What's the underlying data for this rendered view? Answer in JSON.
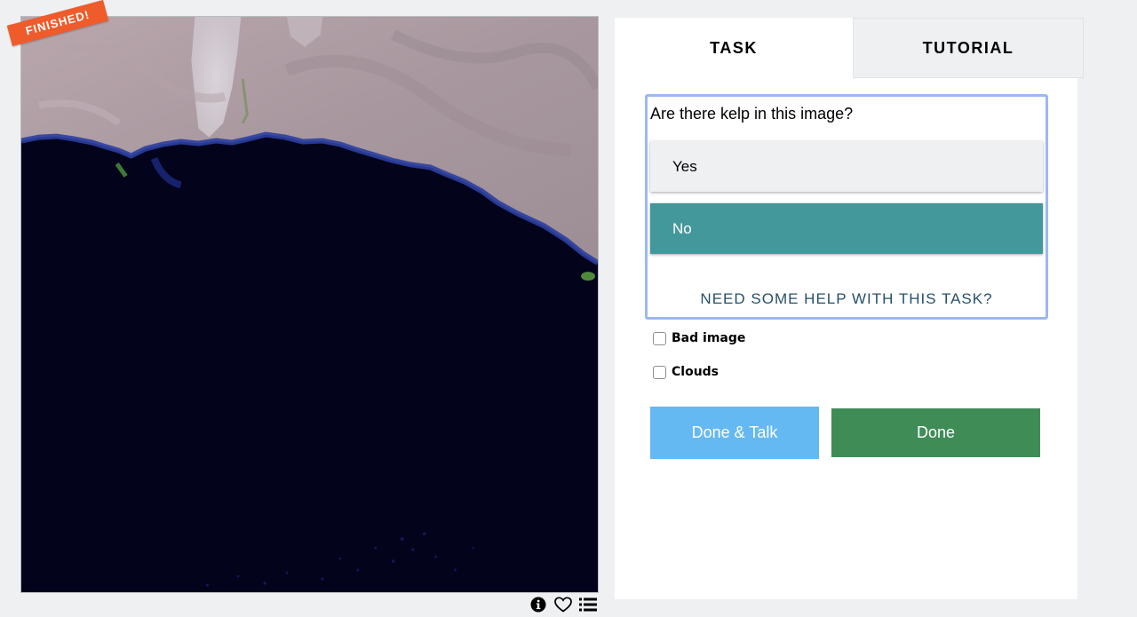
{
  "subject": {
    "finished_label": "FINISHED!"
  },
  "meta_tools": [
    {
      "name": "info-icon"
    },
    {
      "name": "heart-icon"
    },
    {
      "name": "list-icon"
    }
  ],
  "tabs": {
    "task": "TASK",
    "tutorial": "TUTORIAL"
  },
  "task": {
    "question": "Are there kelp in this image?",
    "answers": [
      {
        "label": "Yes",
        "selected": false
      },
      {
        "label": "No",
        "selected": true
      }
    ],
    "help_link": "NEED SOME HELP WITH THIS TASK?"
  },
  "checkboxes": [
    {
      "label": "Bad image",
      "checked": false
    },
    {
      "label": "Clouds",
      "checked": false
    }
  ],
  "buttons": {
    "done_talk": "Done & Talk",
    "done": "Done"
  },
  "colors": {
    "finished_banner": "#ef5b2b",
    "selected_answer": "#43989b",
    "done_talk": "#65b9f2",
    "done": "#3f8c57",
    "question_border": "#9cb7f3"
  }
}
